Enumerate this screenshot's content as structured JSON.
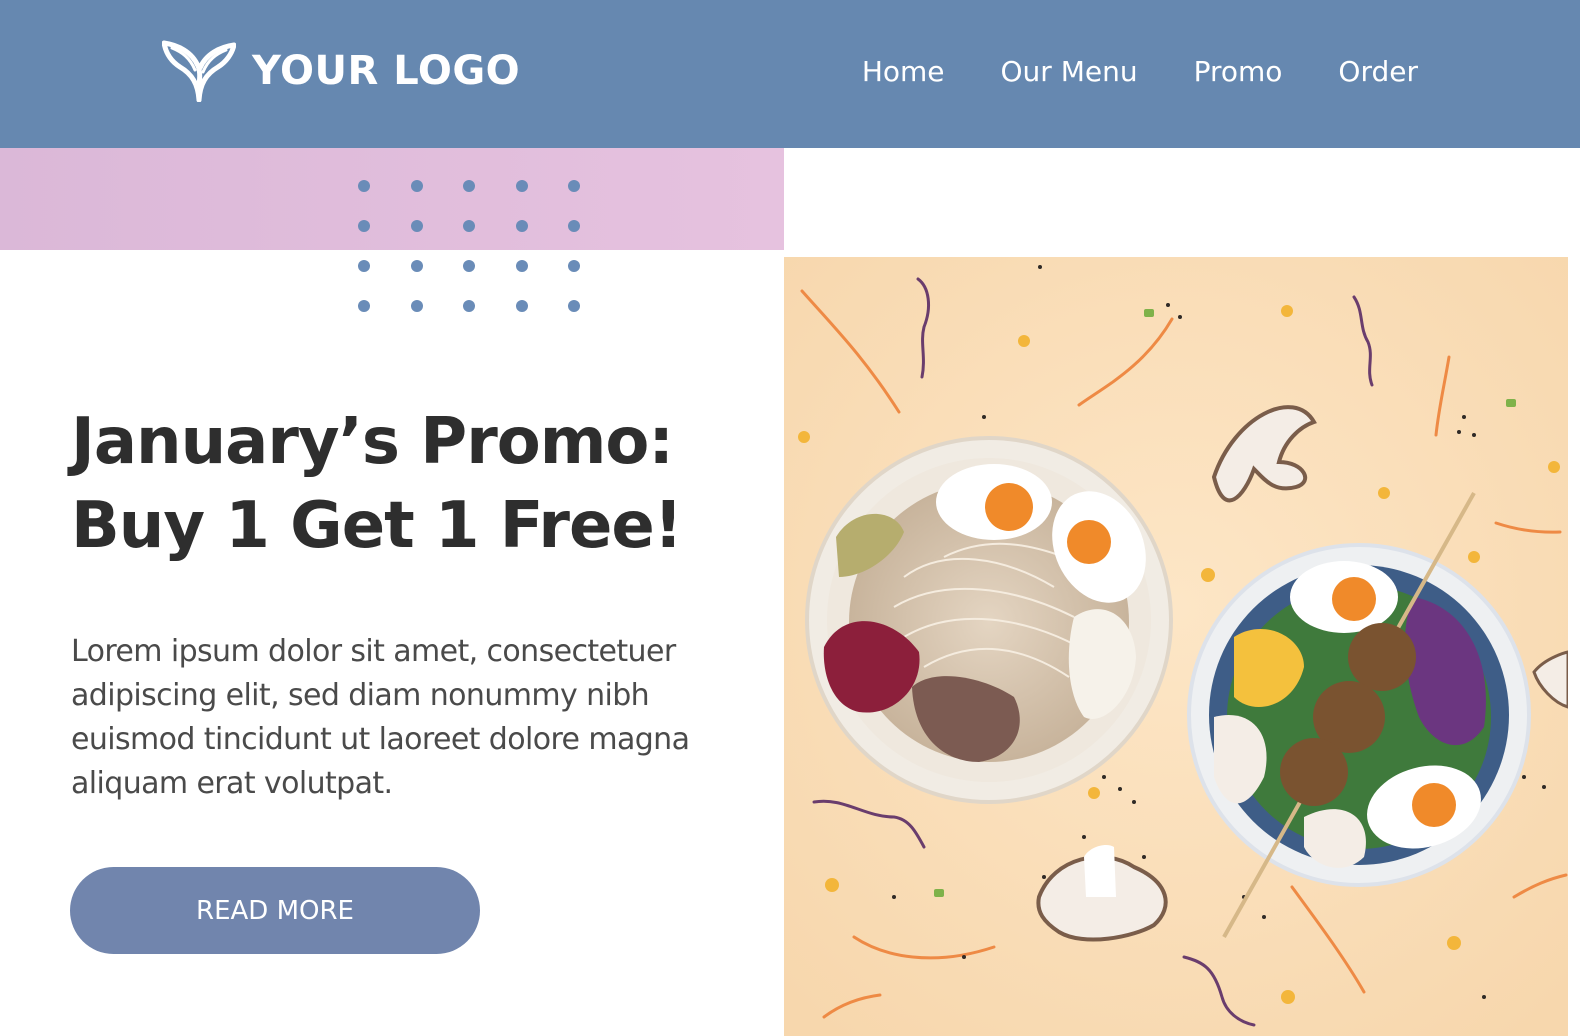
{
  "header": {
    "logo_text": "YOUR LOGO",
    "logo_icon": "leaf-icon",
    "nav": [
      {
        "label": "Home"
      },
      {
        "label": "Our Menu"
      },
      {
        "label": "Promo"
      },
      {
        "label": "Order"
      }
    ]
  },
  "hero": {
    "headline_line1": "January’s Promo:",
    "headline_line2": "Buy 1 Get 1 Free!",
    "body": "Lorem ipsum dolor sit amet, consectetuer adipiscing elit, sed diam nonummy nibh euismod tincidunt ut laoreet dolore magna aliquam erat volutpat.",
    "button_label": "READ MORE",
    "image": "ramen-bowls-photo"
  },
  "colors": {
    "header_bg": "#6688b0",
    "pink_band": "#e2bedc",
    "dot_color": "#6a8cb8",
    "button_bg": "#7185ad",
    "headline": "#2e2e2e",
    "body_text": "#4a4a4a",
    "photo_bg": "#fbe0bd"
  }
}
